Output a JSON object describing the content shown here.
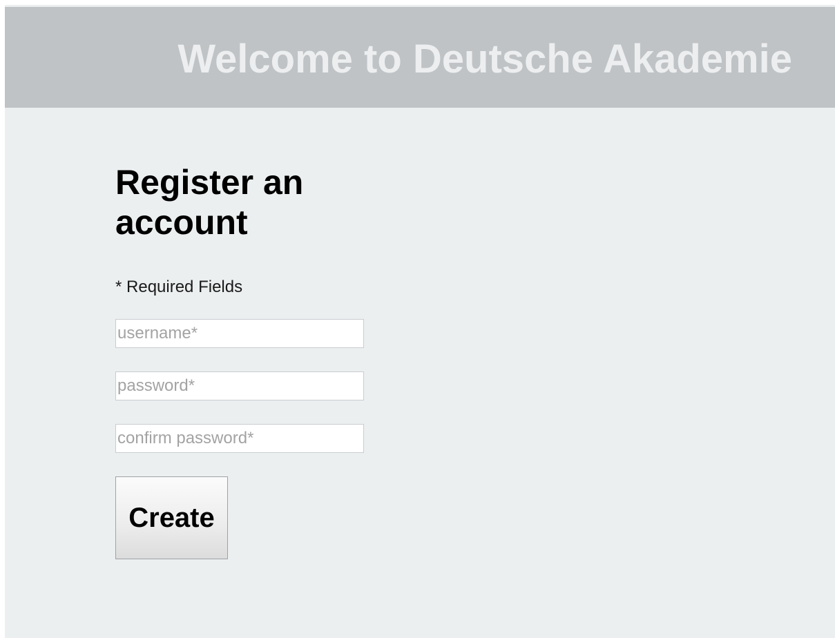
{
  "header": {
    "title": "Welcome to Deutsche Akademie"
  },
  "form": {
    "heading": "Register an account",
    "required_note": "* Required Fields",
    "username": {
      "value": "",
      "placeholder": "username*"
    },
    "password": {
      "value": "",
      "placeholder": "password*"
    },
    "confirm_password": {
      "value": "",
      "placeholder": "confirm password*"
    },
    "create_label": "Create"
  },
  "colors": {
    "header_background": "#bfc3c6",
    "header_text": "#eceeef",
    "page_background": "#eceff0"
  }
}
